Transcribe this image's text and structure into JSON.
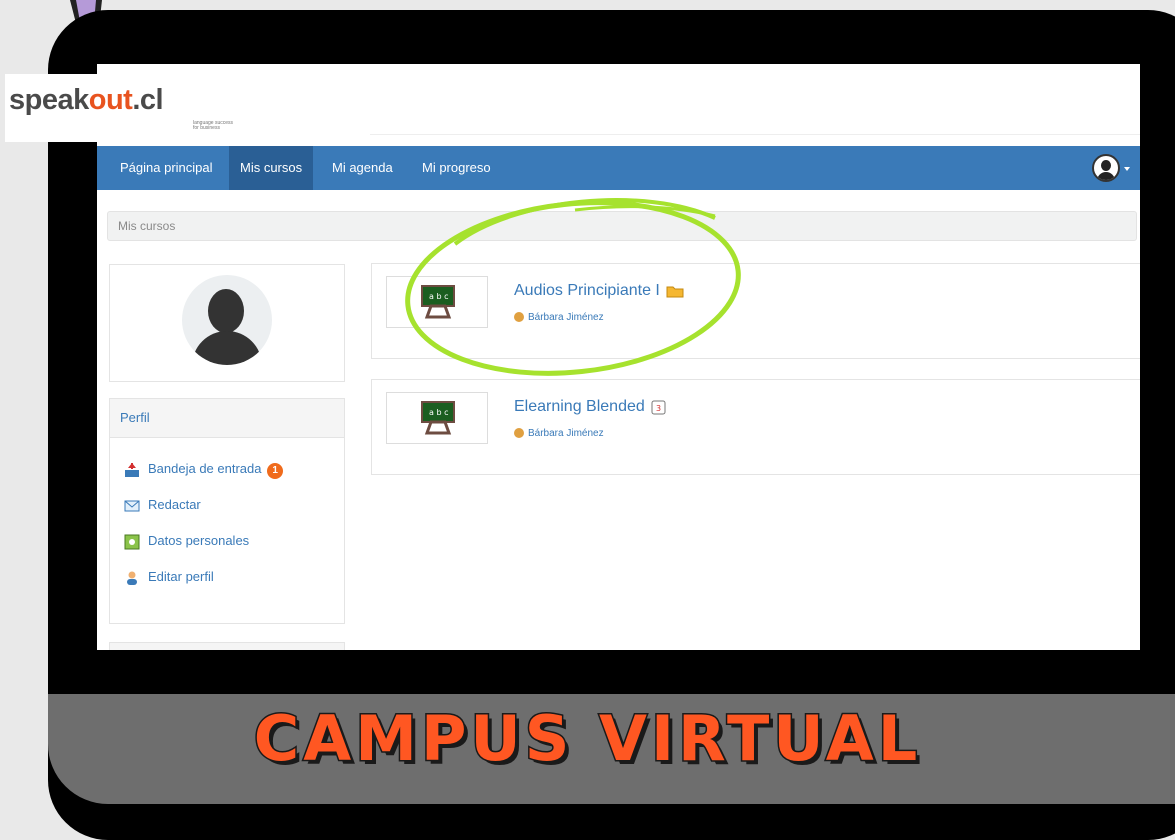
{
  "brand": {
    "logo_prefix": "speak",
    "logo_out": "out",
    "logo_suffix": ".cl",
    "tagline_line1": "language success",
    "tagline_line2": "for business"
  },
  "nav": {
    "items": [
      {
        "label": "Página principal"
      },
      {
        "label": "Mis cursos"
      },
      {
        "label": "Mi agenda"
      },
      {
        "label": "Mi progreso"
      }
    ],
    "active": "Mis cursos",
    "user_icon": "user-icon"
  },
  "breadcrumb": "Mis cursos",
  "profile": {
    "title": "Perfil",
    "items": [
      {
        "label": "Bandeja de entrada",
        "icon": "inbox-icon",
        "badge": "1"
      },
      {
        "label": "Redactar",
        "icon": "compose-icon"
      },
      {
        "label": "Datos personales",
        "icon": "personal-data-icon"
      },
      {
        "label": "Editar perfil",
        "icon": "edit-profile-icon"
      }
    ]
  },
  "courses": [
    {
      "title": "Audios Principiante I",
      "teacher": "Bárbara Jiménez",
      "thumb_icon": "chalkboard-icon",
      "title_icon": "folder-icon"
    },
    {
      "title": "Elearning Blended",
      "teacher": "Bárbara Jiménez",
      "thumb_icon": "chalkboard-icon",
      "title_icon": "session-icon"
    }
  ],
  "banner": "CAMPUS VIRTUAL",
  "colors": {
    "nav": "#3a7ab8",
    "nav_active": "#2a5f95",
    "link": "#3a7ab8",
    "badge": "#f06b1c",
    "banner_text": "#ff5722",
    "highlight": "#a6e22e"
  }
}
